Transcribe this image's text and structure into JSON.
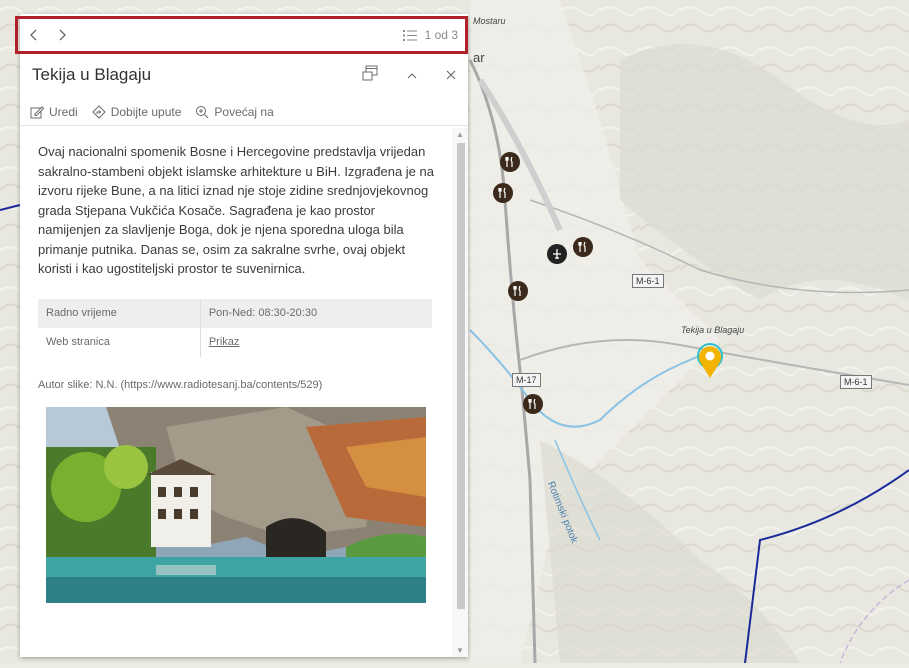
{
  "map": {
    "labels": {
      "mostaru": "Mostaru",
      "ar": "ar",
      "tekija": "Tekija u Blagaju",
      "potok": "Rotimski potok"
    },
    "shields": {
      "m6_1_a": "M-6-1",
      "m6_1_b": "M-6-1",
      "m17": "M-17"
    },
    "colors": {
      "accent_marker": "#f2b400",
      "marker_ring": "#2ec0c8",
      "boundary": "#1a2a9a",
      "river": "#89c3e6"
    }
  },
  "popup": {
    "nav": {
      "prev_icon": "chevron-left-icon",
      "next_icon": "chevron-right-icon",
      "pager_text": "1 od 3"
    },
    "title": "Tekija u Blagaju",
    "header_icons": [
      "dock-icon",
      "collapse-icon",
      "close-icon"
    ],
    "actions": {
      "edit": "Uredi",
      "directions": "Dobijte upute",
      "zoom": "Povećaj na"
    },
    "description": "Ovaj nacionalni spomenik Bosne i Hercegovine predstavlja vrijedan sakralno-stambeni objekt islamske arhitekture u BiH. Izgrađena je na izvoru rijeke Bune, a na litici iznad nje stoje zidine srednjovjekovnog grada Stjepana Vukčića Kosače. Sagrađena je kao prostor namijenjen za slavljenje Boga, dok je njena sporedna uloga bila primanje putnika. Danas se, osim za sakralne svrhe, ovaj objekt koristi i kao ugostiteljski prostor te suvenirnica.",
    "attributes": [
      {
        "label": "Radno vrijeme",
        "value": "Pon-Ned: 08:30-20:30"
      },
      {
        "label": "Web stranica",
        "value": "Prikaz"
      }
    ],
    "credit": "Autor slike: N.N. (https://www.radiotesanj.ba/contents/529)"
  }
}
